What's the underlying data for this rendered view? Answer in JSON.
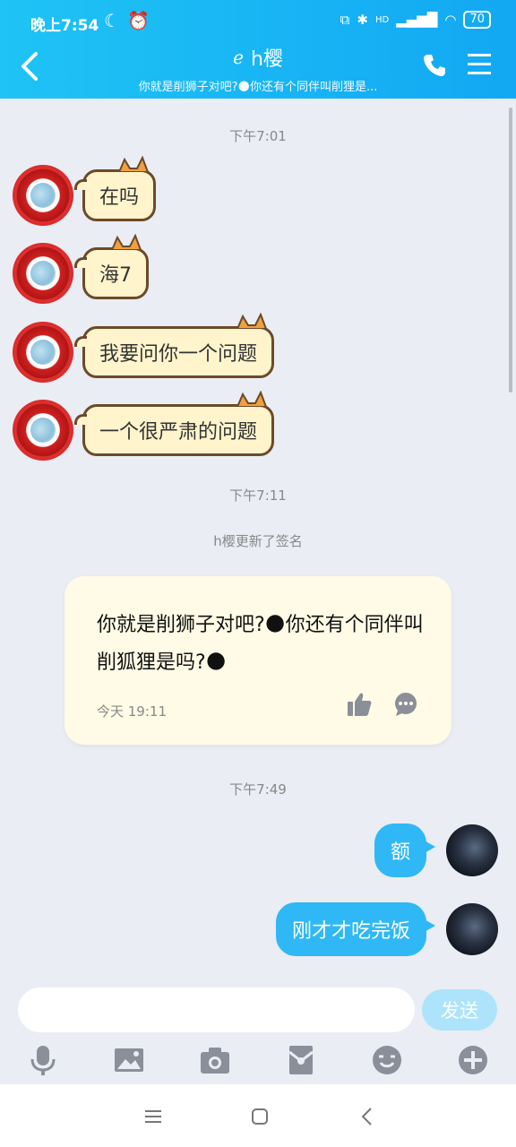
{
  "status_bar": {
    "time": "晚上7:54",
    "battery": "70",
    "network": "HD"
  },
  "header": {
    "back_icon": "chevron-left-icon",
    "title": "h樱",
    "subtitle": "你就是削狮子对吧?🌑你还有个同伴叫削狸是...",
    "call_icon": "phone-icon",
    "menu_icon": "menu-icon"
  },
  "chat": {
    "timestamps": [
      "下午7:01",
      "下午7:11",
      "下午7:49"
    ],
    "incoming": [
      "在吗",
      "海7",
      "我要问你一个问题",
      "一个很严肃的问题"
    ],
    "system_notice": "h樱更新了签名",
    "signature_card": {
      "text": "你就是削狮子对吧?🌑你还有个同伴叫削狐狸是吗?🌑",
      "date": "今天 19:11",
      "like_icon": "thumbs-up-icon",
      "comment_icon": "comment-icon"
    },
    "outgoing": [
      "额",
      "刚才才吃完饭"
    ]
  },
  "input": {
    "placeholder": "",
    "send_label": "发送"
  },
  "toolbar": [
    "mic-icon",
    "image-icon",
    "camera-icon",
    "red-packet-icon",
    "emoji-icon",
    "plus-icon"
  ],
  "colors": {
    "header_start": "#1fc3f5",
    "header_end": "#12a8f3",
    "outgoing_bubble": "#2fb8f5",
    "card_bg": "#fffbe6",
    "chat_bg": "#eaedf4"
  }
}
